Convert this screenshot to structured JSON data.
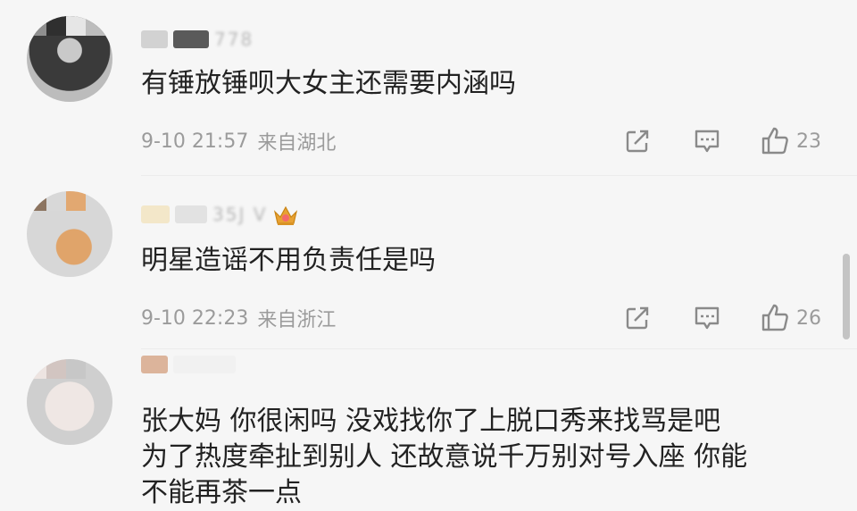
{
  "comments": [
    {
      "username_suffix": "778",
      "text": "有锤放锤呗大女主还需要内涵吗",
      "date": "9-10 21:57",
      "location": "来自湖北",
      "likes": "23"
    },
    {
      "username_suffix": "35J V",
      "text": "明星造谣不用负责任是吗",
      "date": "9-10 22:23",
      "location": "来自浙江",
      "likes": "26"
    },
    {
      "username_suffix": "",
      "text_lines": [
        "张大妈 你很闲吗 没戏找你了上脱口秀来找骂是吧",
        "为了热度牵扯到别人 还故意说千万别对号入座 你能",
        "不能再茶一点"
      ]
    }
  ],
  "icons": {
    "share": "share-icon",
    "comment": "comment-icon",
    "like": "thumbs-up-icon",
    "badge": "crown-badge-icon"
  },
  "colors": {
    "meta_text": "#9b9b9b",
    "body_text": "#222222",
    "background": "#f6f6f6",
    "badge": "#e8a233"
  }
}
